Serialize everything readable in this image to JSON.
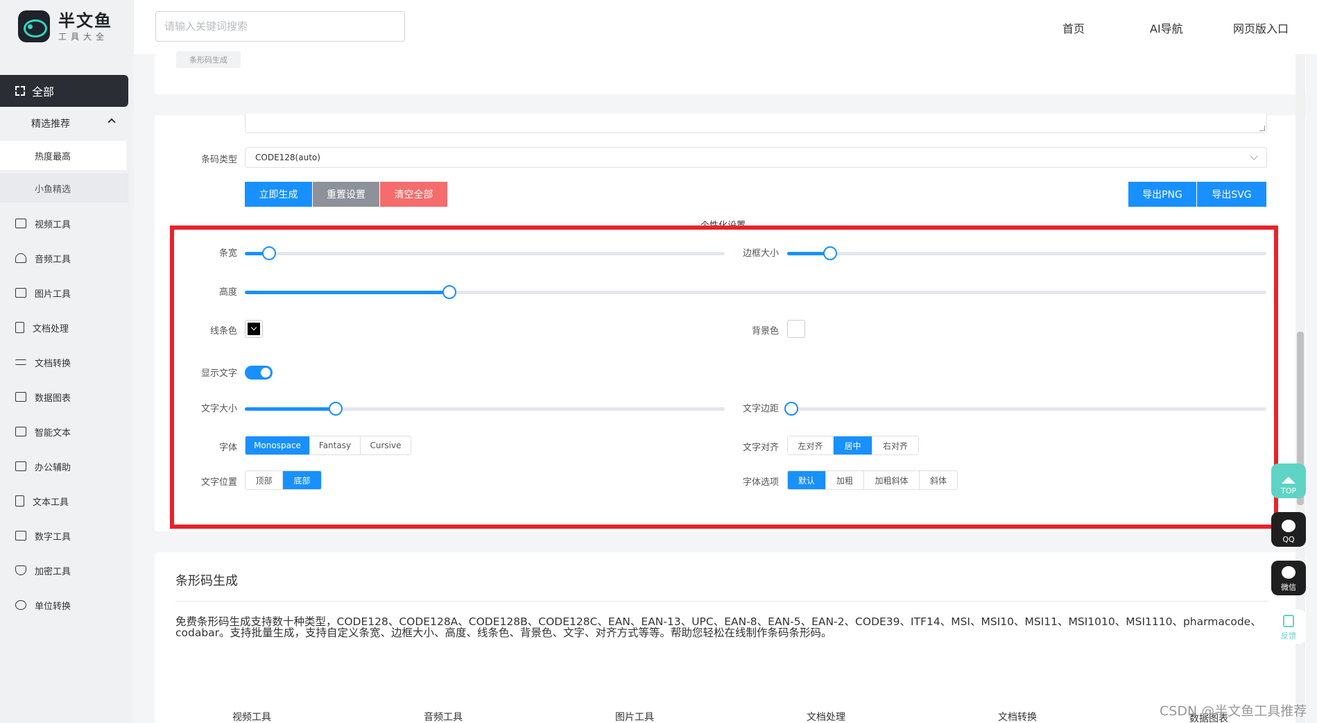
{
  "brand": {
    "title": "半文鱼",
    "subtitle": "工具大全"
  },
  "search": {
    "placeholder": "请输入关键词搜索"
  },
  "topnav": {
    "home": "首页",
    "ai_nav": "AI导航",
    "web_entry": "网页版入口"
  },
  "sidebar": {
    "all": "全部",
    "featured": "精选推荐",
    "sub_items": [
      "热度最高",
      "小鱼精选"
    ],
    "items": [
      "视频工具",
      "音频工具",
      "图片工具",
      "文档处理",
      "文档转换",
      "数据图表",
      "智能文本",
      "办公辅助",
      "文本工具",
      "数字工具",
      "加密工具",
      "单位转换"
    ]
  },
  "breadcrumb_tag": "条形码生成",
  "form": {
    "barcode_type_label": "条码类型",
    "barcode_type_value": "CODE128(auto)",
    "buttons": {
      "generate": "立即生成",
      "reset": "重置设置",
      "clear": "清空全部",
      "export_png": "导出PNG",
      "export_svg": "导出SVG"
    },
    "section_title": "个性化设置",
    "bar_width_label": "条宽",
    "bar_width_value": 0.05,
    "border_size_label": "边框大小",
    "border_size_value": 0.09,
    "height_label": "高度",
    "height_value": 0.2,
    "line_color_label": "线条色",
    "line_color": "#000000",
    "bg_color_label": "背景色",
    "bg_color": "#ffffff",
    "show_text_label": "显示文字",
    "show_text": true,
    "font_size_label": "文字大小",
    "font_size_value": 0.19,
    "text_margin_label": "文字边距",
    "text_margin_value": 0.0,
    "font_label": "字体",
    "font_options": [
      "Monospace",
      "Fantasy",
      "Cursive"
    ],
    "font_selected": "Monospace",
    "text_align_label": "文字对齐",
    "text_align_options": [
      "左对齐",
      "居中",
      "右对齐"
    ],
    "text_align_selected": "居中",
    "text_position_label": "文字位置",
    "text_position_options": [
      "顶部",
      "底部"
    ],
    "text_position_selected": "底部",
    "font_option_label": "字体选项",
    "font_style_options": [
      "默认",
      "加粗",
      "加粗斜体",
      "斜体"
    ],
    "font_style_selected": "默认"
  },
  "description": {
    "title": "条形码生成",
    "text": "免费条形码生成支持数十种类型，CODE128、CODE128A、CODE128B、CODE128C、EAN、EAN-13、UPC、EAN-8、EAN-5、EAN-2、CODE39、ITF14、MSI、MSI10、MSI11、MSI1010、MSI1110、pharmacode、codabar。支持批量生成，支持自定义条宽、边框大小、高度、线条色、背景色、文字、对齐方式等等。帮助您轻松在线制作条码条形码。"
  },
  "footer_categories": [
    "视频工具",
    "音频工具",
    "图片工具",
    "文档处理",
    "文档转换",
    "数据图表"
  ],
  "floating": {
    "top": "TOP",
    "qq": "QQ",
    "wechat": "微信",
    "feedback": "反馈"
  },
  "watermark": "CSDN @半文鱼工具推荐",
  "colors": {
    "accent": "#1890ff",
    "danger": "#f56c6c",
    "highlight_box": "#e8212b",
    "teal": "#5fd3c6"
  }
}
